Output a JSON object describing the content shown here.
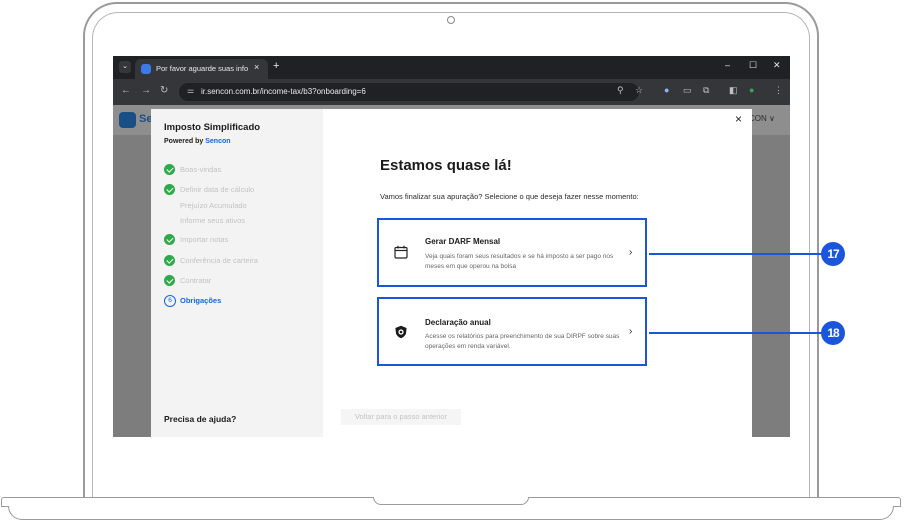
{
  "browser": {
    "tab_title": "Por favor aguarde suas informa...",
    "tab_close": "×",
    "new_tab": "+",
    "url": "ir.sencon.com.br/income-tax/b3?onboarding=6",
    "window_controls": {
      "minimize": "–",
      "maximize": "☐",
      "close": "✕"
    }
  },
  "page": {
    "brand_partial": "Se",
    "user_menu": "CON ∨"
  },
  "modal": {
    "close": "×",
    "sidebar": {
      "title": "Imposto Simplificado",
      "powered_by": "Powered by",
      "brand": "Sencon",
      "steps": [
        {
          "label": "Boas-vindas",
          "status": "done"
        },
        {
          "label": "Definir data de cálculo",
          "status": "done"
        },
        {
          "label": "Prejuízo Acumulado",
          "status": "sub"
        },
        {
          "label": "Informe seus ativos",
          "status": "sub"
        },
        {
          "label": "Importar notas",
          "status": "done"
        },
        {
          "label": "Conferência de carteira",
          "status": "done"
        },
        {
          "label": "Contratar",
          "status": "done"
        },
        {
          "label": "Obrigações",
          "status": "active",
          "number": "6"
        }
      ],
      "help": "Precisa de ajuda?"
    },
    "heading": "Estamos quase lá!",
    "instruction": "Vamos finalizar sua apuração? Selecione o que deseja fazer nesse momento:",
    "options": [
      {
        "title": "Gerar DARF Mensal",
        "description": "Veja quais foram seus resultados e se há imposto a ser pago nos meses em que operou na bolsa",
        "icon": "calendar-icon",
        "badge": "17"
      },
      {
        "title": "Declaração anual",
        "description": "Acesse os relatórios para preenchimento de sua DIRPF sobre suas operações em renda variável.",
        "icon": "lion-logo-icon",
        "badge": "18"
      }
    ],
    "back_button": "Voltar para o passo anterior"
  },
  "colors": {
    "callout_blue": "#1a56db",
    "success_green": "#2eaa4a",
    "link_blue": "#1565e0"
  }
}
